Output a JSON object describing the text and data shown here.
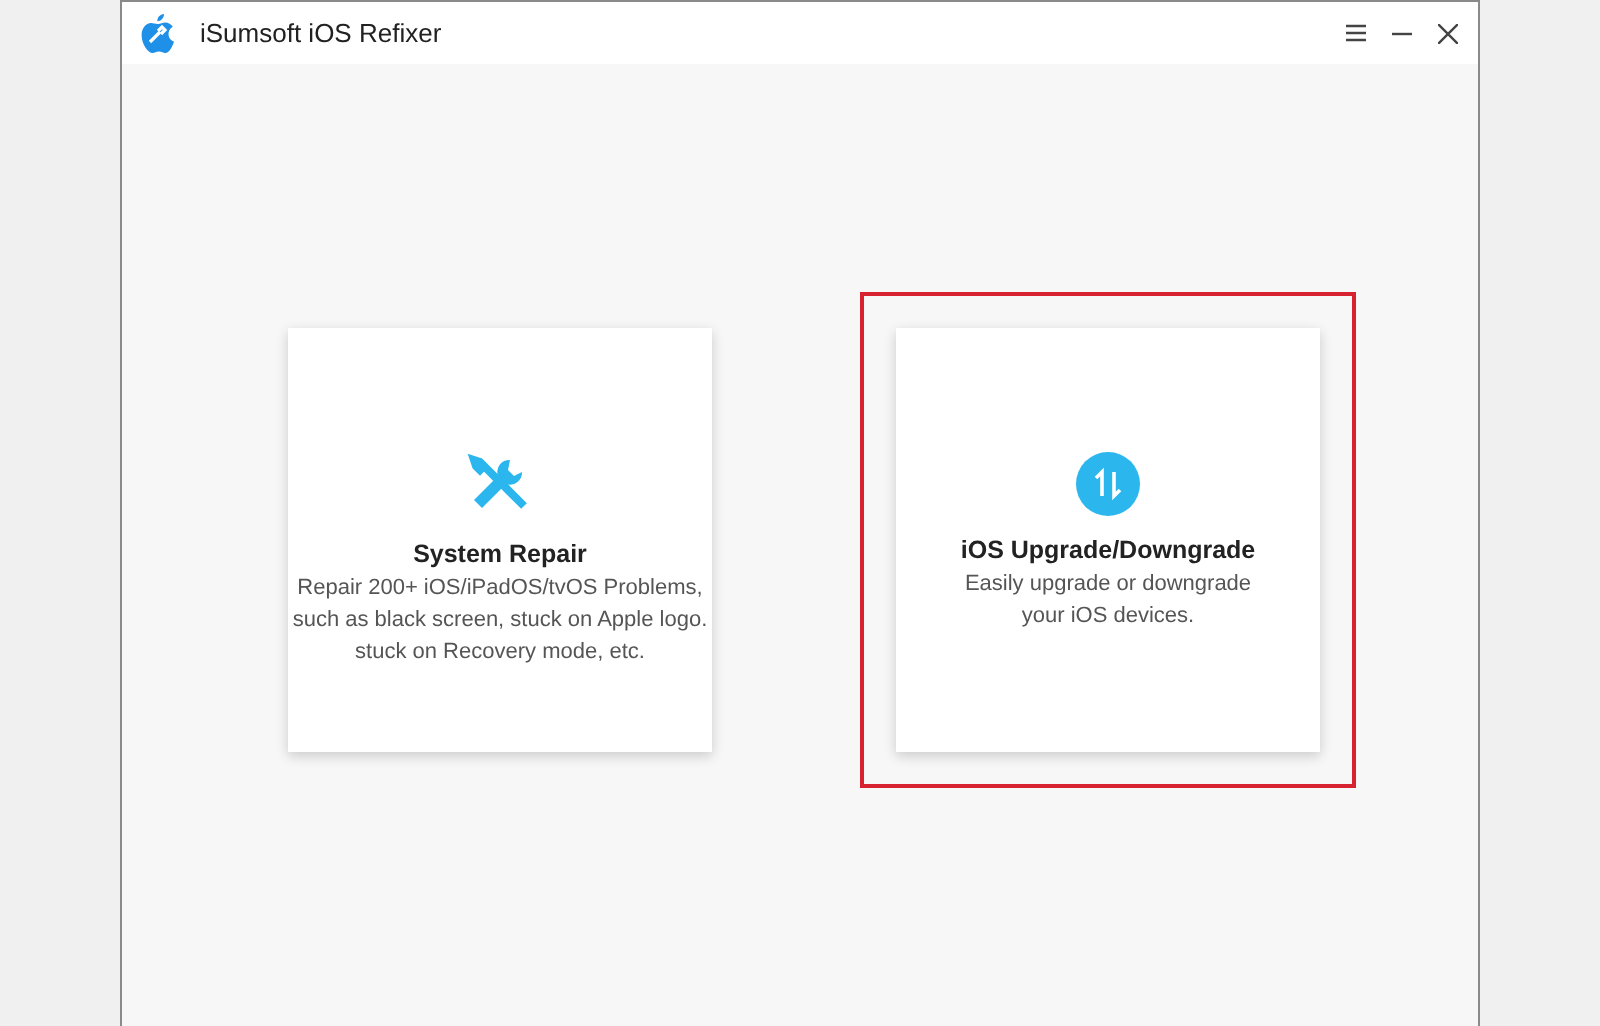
{
  "window": {
    "title": "iSumsoft iOS Refixer"
  },
  "cards": [
    {
      "kind": "repair",
      "title": "System Repair",
      "description": "Repair 200+ iOS/iPadOS/tvOS Problems,\nsuch as black screen, stuck on Apple logo.\nstuck on Recovery mode, etc.",
      "highlighted": false
    },
    {
      "kind": "upgrade",
      "title": "iOS Upgrade/Downgrade",
      "description": "Easily upgrade or downgrade\nyour iOS devices.",
      "highlighted": true
    }
  ]
}
